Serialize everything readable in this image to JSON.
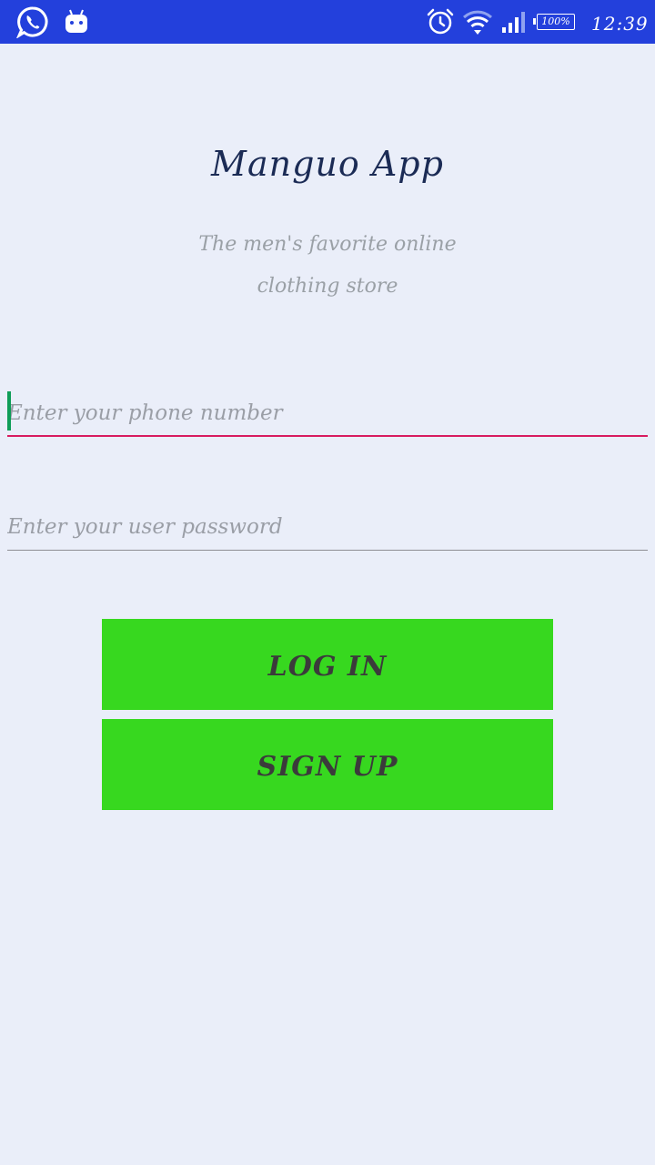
{
  "status_bar": {
    "time": "12:39",
    "battery": "100%",
    "icons": [
      "whatsapp-icon",
      "android-icon",
      "alarm-icon",
      "wifi-icon",
      "signal-icon",
      "battery-icon"
    ],
    "background": "#2340dc"
  },
  "header": {
    "title": "Manguo App",
    "subtitle_line1": "The men's favorite online",
    "subtitle_line2": "clothing store"
  },
  "form": {
    "phone": {
      "value": "",
      "placeholder": "Enter your phone number"
    },
    "password": {
      "value": "",
      "placeholder": "Enter your user password"
    }
  },
  "buttons": {
    "login": "LOG IN",
    "signup": "SIGN UP"
  },
  "colors": {
    "background": "#eaeef9",
    "title": "#1b2b55",
    "button": "#37d81f",
    "active_underline": "#d81b60",
    "cursor": "#0f9d58"
  }
}
